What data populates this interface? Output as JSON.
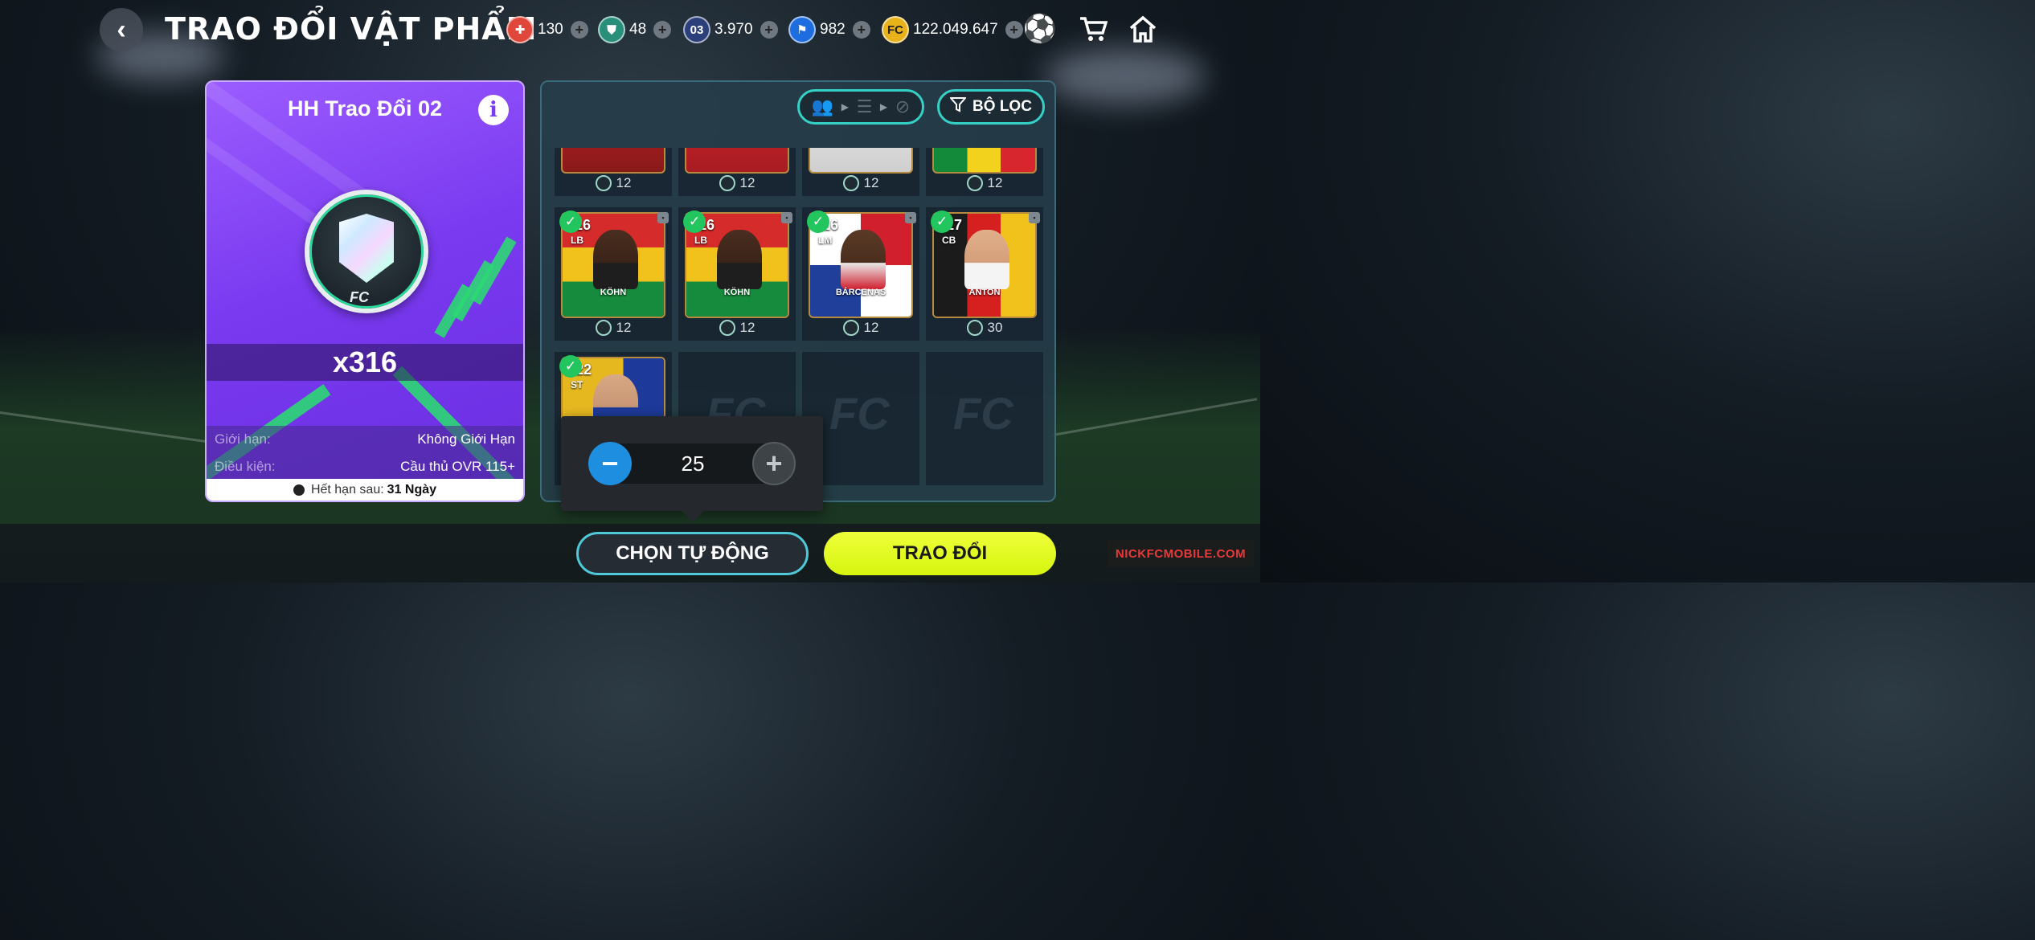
{
  "header": {
    "title": "TRAO ĐỔI VẬT PHẨM",
    "back_icon": "chevron-left-icon"
  },
  "currencies": [
    {
      "icon": "puzzle-token-icon",
      "value": "130",
      "color": "#e0463a"
    },
    {
      "icon": "shield-token-icon",
      "value": "48",
      "color": "#2a8f7a"
    },
    {
      "icon": "card-token-icon",
      "label": "03",
      "value": "3.970",
      "color": "#2b3f7a"
    },
    {
      "icon": "boot-token-icon",
      "value": "982",
      "color": "#1e6de0"
    },
    {
      "icon": "fc-coin-icon",
      "value": "122.049.647",
      "color": "#e8b21a"
    }
  ],
  "top_icons": [
    "ball-icon",
    "cart-icon",
    "home-icon"
  ],
  "item_card": {
    "title": "HH Trao Đổi 02",
    "quantity": "x316",
    "limit_label": "Giới hạn:",
    "limit_value": "Không Giới Hạn",
    "condition_label": "Điều kiện:",
    "condition_value": "Cầu thủ OVR 115+",
    "expiry_label": "Hết hạn sau:",
    "expiry_value": "31 Ngày",
    "badge_mark": "FC"
  },
  "filter": {
    "button_label": "BỘ LỌC"
  },
  "top_row_costs": [
    "12",
    "12",
    "12",
    "12"
  ],
  "players": [
    {
      "ovr": "116",
      "pos": "LB",
      "name": "KÖHN",
      "cost": "12",
      "selected": true
    },
    {
      "ovr": "116",
      "pos": "LB",
      "name": "KÖHN",
      "cost": "12",
      "selected": true
    },
    {
      "ovr": "116",
      "pos": "LM",
      "name": "BÁRCENAS",
      "cost": "12",
      "selected": true
    },
    {
      "ovr": "117",
      "pos": "CB",
      "name": "ANTON",
      "cost": "30",
      "selected": true
    },
    {
      "ovr": "122",
      "pos": "ST",
      "name": "",
      "cost": "",
      "selected": true
    }
  ],
  "empty_slot_mark": "FC",
  "stepper": {
    "value": "25"
  },
  "actions": {
    "auto_label": "CHỌN TỰ ĐỘNG",
    "trade_label": "TRAO ĐỔI"
  },
  "watermark": "NICKFCMOBILE.COM"
}
